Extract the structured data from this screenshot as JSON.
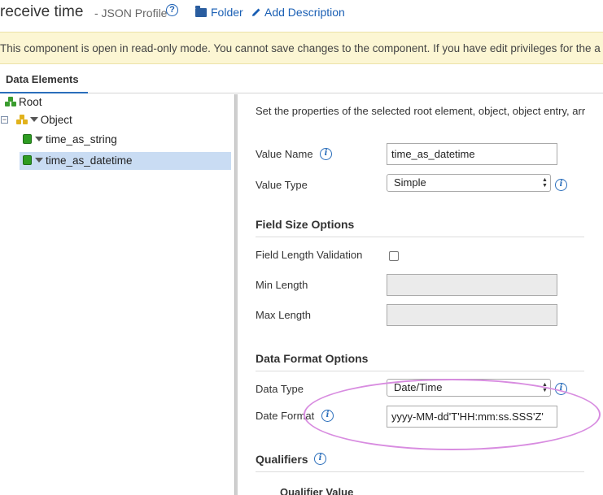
{
  "header": {
    "title": "receive time",
    "subtitle": "- JSON Profile",
    "help_glyph": "?",
    "folder_label": "Folder",
    "add_description_label": "Add Description"
  },
  "banner": {
    "text": "This component is open in read-only mode. You cannot save changes to the component. If you have edit privileges for the a"
  },
  "tabs": [
    {
      "label": "Data Elements",
      "active": true
    }
  ],
  "tree": {
    "root": "Root",
    "object": "Object",
    "entries": [
      "time_as_string",
      "time_as_datetime"
    ],
    "selected": "time_as_datetime",
    "collapse_glyph": "−"
  },
  "panel": {
    "intro": "Set the properties of the selected root element, object, object entry, arr",
    "value_name_label": "Value Name",
    "value_name": "time_as_datetime",
    "value_type_label": "Value Type",
    "value_type": "Simple",
    "field_size_title": "Field Size Options",
    "field_length_validation_label": "Field Length Validation",
    "field_length_validation_checked": false,
    "min_length_label": "Min Length",
    "min_length": "",
    "max_length_label": "Max Length",
    "max_length": "",
    "data_format_title": "Data Format Options",
    "data_type_label": "Data Type",
    "data_type": "Date/Time",
    "date_format_label": "Date Format",
    "date_format": "yyyy-MM-dd'T'HH:mm:ss.SSS'Z'",
    "qualifiers_title": "Qualifiers",
    "qualifier_value_label": "Qualifier Value",
    "info_glyph": "i"
  },
  "colors": {
    "link": "#1a5fb4",
    "banner_bg": "#fcf6d3",
    "selected_row": "#c9dcf3",
    "annotation": "#d88ce0"
  },
  "icons": [
    "help-icon",
    "folder-icon",
    "pencil-icon",
    "root-icon",
    "object-icon",
    "entry-icon",
    "info-icon",
    "select-arrows-icon",
    "expand-triangle-icon"
  ]
}
